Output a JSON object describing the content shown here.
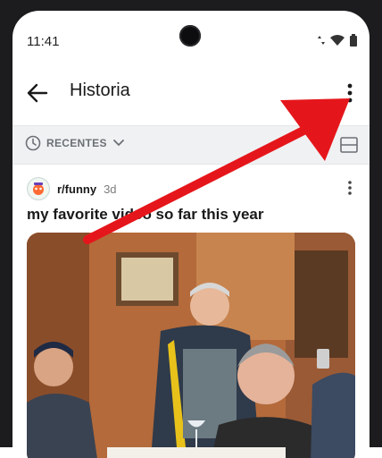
{
  "status_bar": {
    "time": "11:41"
  },
  "app_bar": {
    "title": "Historia"
  },
  "toolbar": {
    "sort_label": "RECENTES"
  },
  "post": {
    "subreddit": "r/funny",
    "age": "3d",
    "title": "my favorite video so far this year"
  },
  "colors": {
    "arrow": "#e5161b",
    "toolbar_bg": "#f0f1f3"
  }
}
